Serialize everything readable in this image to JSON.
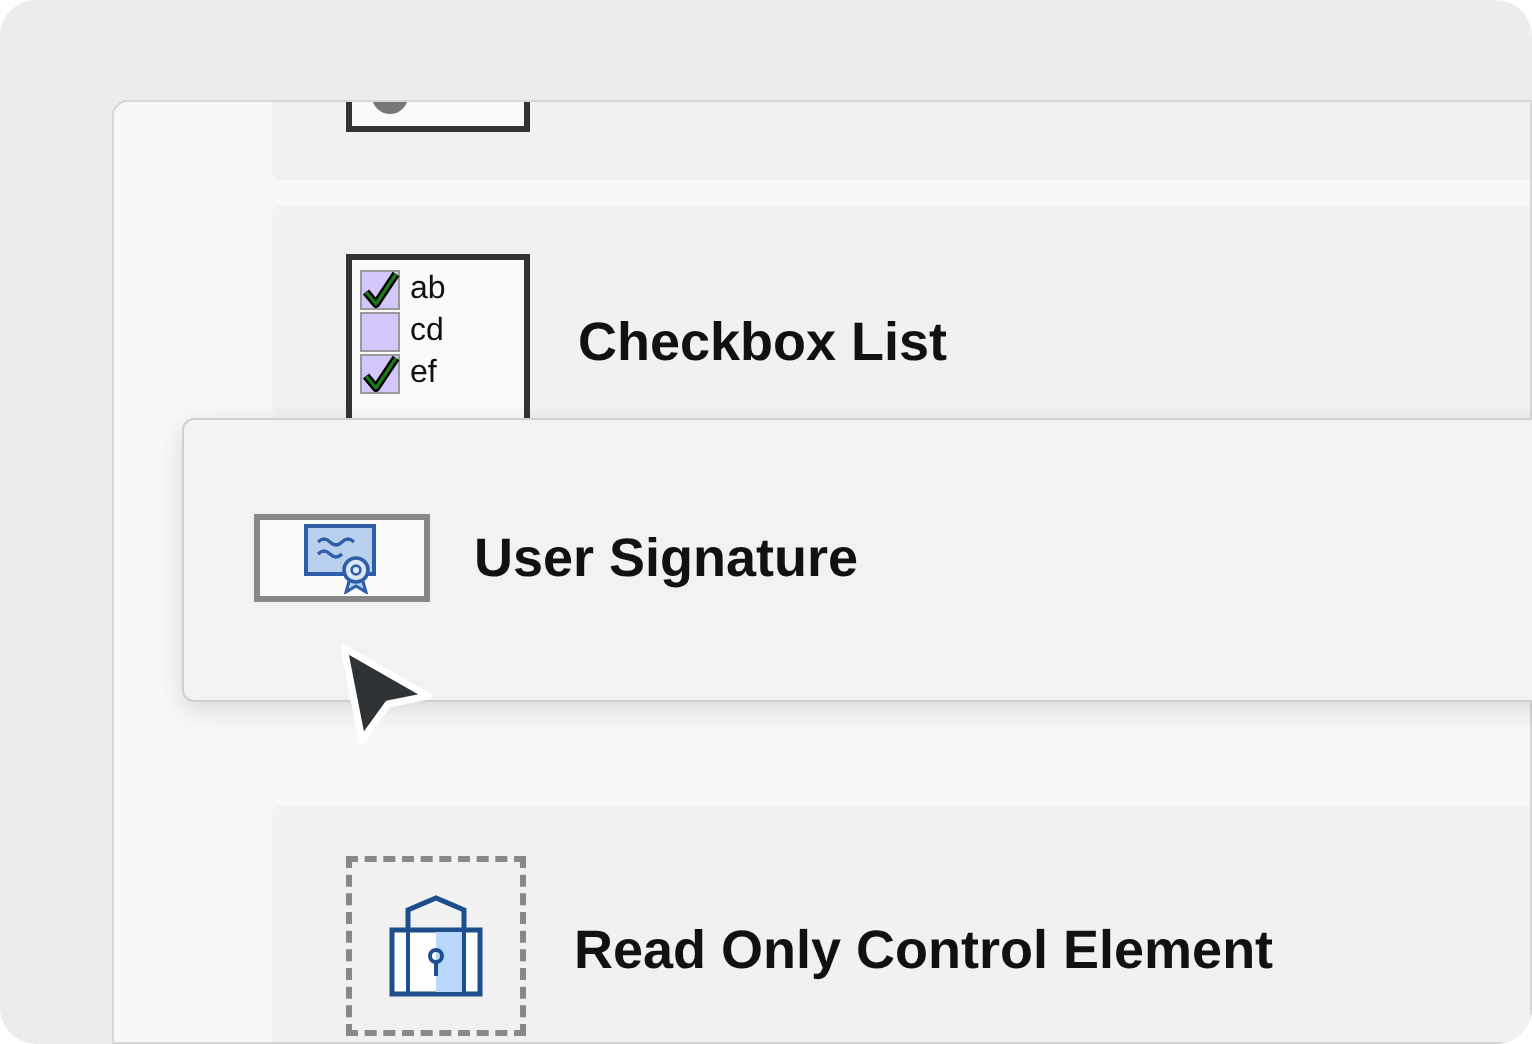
{
  "cards": [
    {
      "kind": "image"
    },
    {
      "kind": "checkbox_list",
      "title": "Checkbox List",
      "preview_items": [
        {
          "label": "ab",
          "checked": true
        },
        {
          "label": "cd",
          "checked": false
        },
        {
          "label": "ef",
          "checked": true
        }
      ]
    },
    {
      "kind": "read_only",
      "title": "Read Only Control Element"
    }
  ],
  "dragged_card": {
    "kind": "signature",
    "title": "User Signature"
  }
}
